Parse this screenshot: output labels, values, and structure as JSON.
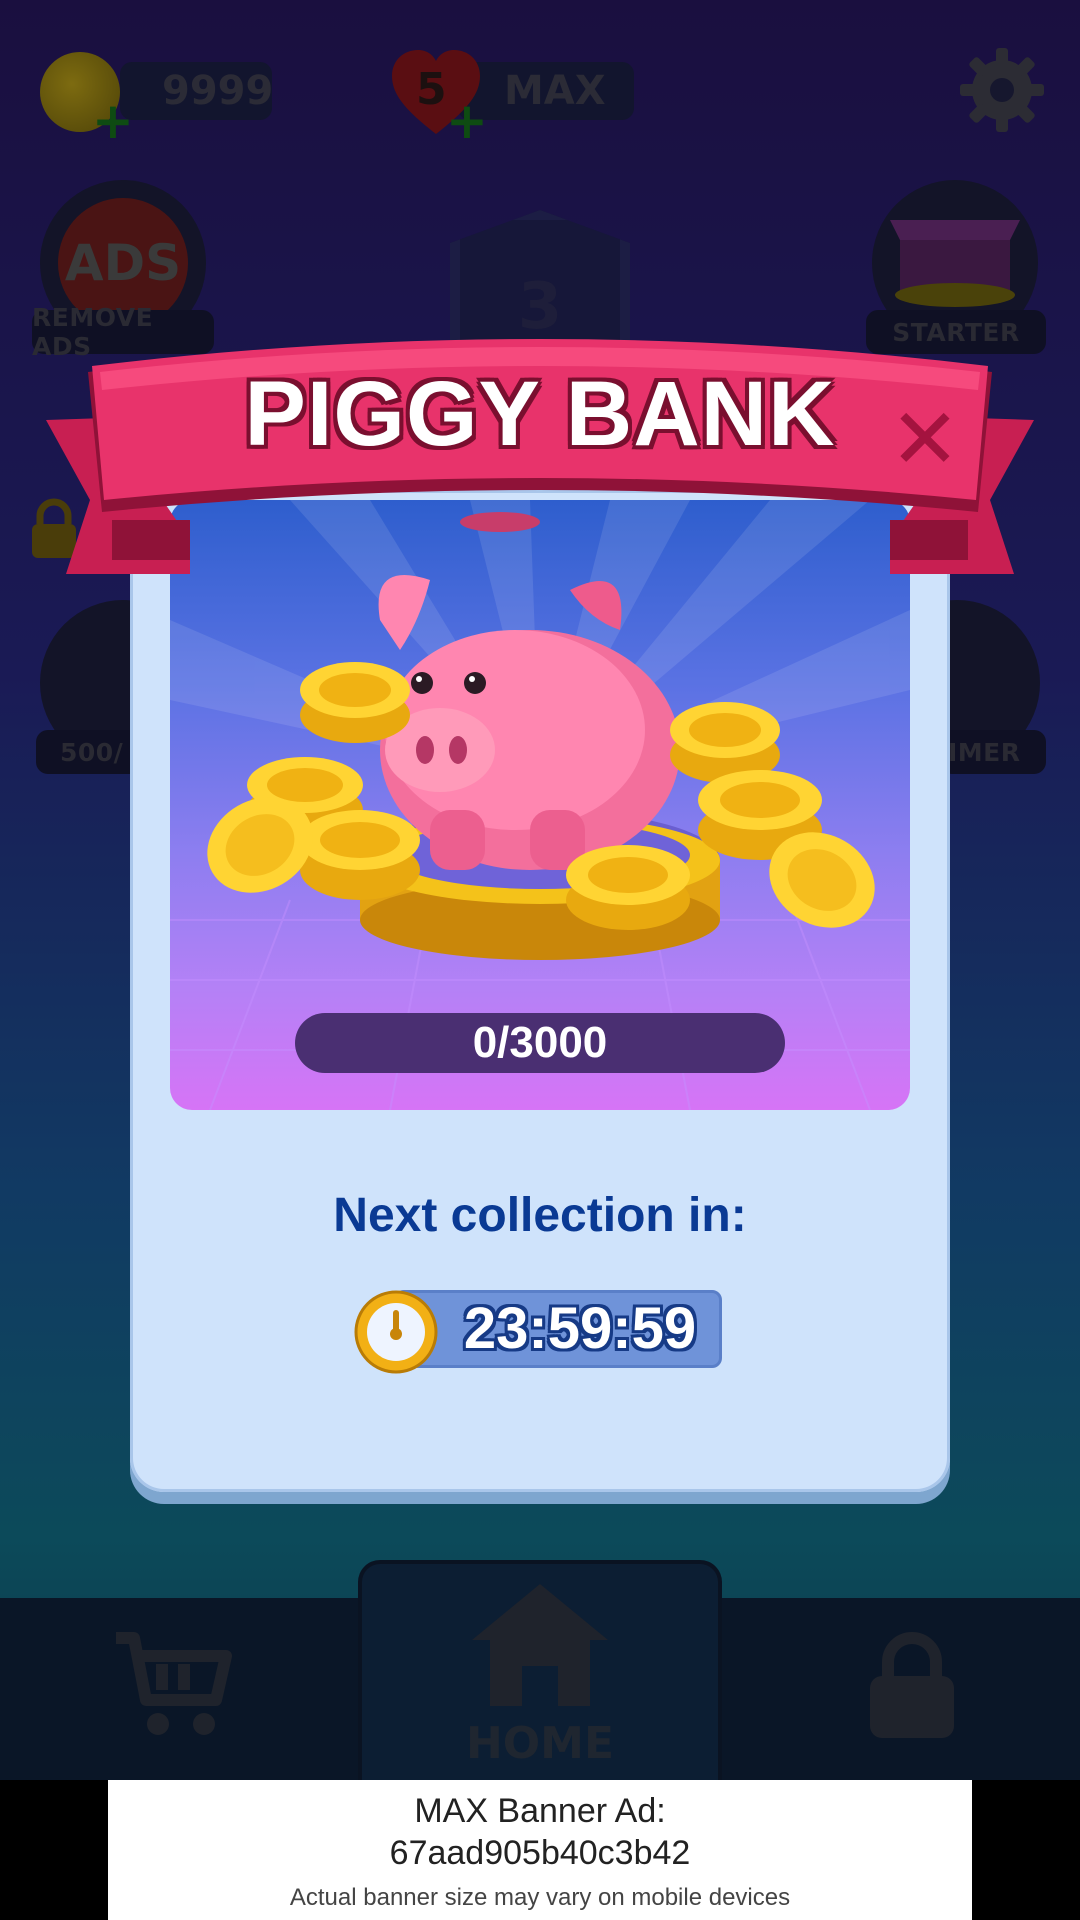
{
  "hud": {
    "coins": "9999",
    "lives": "5",
    "lives_status": "MAX",
    "remove_ads_label": "REMOVE ADS",
    "ads_icon_text": "ADS",
    "starter_label": "STARTER",
    "level": "3",
    "progress_label_partial": "500/",
    "timer_label_partial": "IMER"
  },
  "modal": {
    "title": "PIGGY BANK",
    "close_symbol": "✕",
    "progress": "0/3000",
    "next_label": "Next collection in:",
    "countdown": "23:59:59"
  },
  "nav": {
    "home_label": "HOME"
  },
  "ad": {
    "line1": "MAX Banner Ad:",
    "line2": "67aad905b40c3b42",
    "line3": "Actual banner size may vary on mobile devices"
  },
  "icons": [
    "coin-icon",
    "heart-icon",
    "gear-icon",
    "ads-icon",
    "gift-box-icon",
    "lock-icon",
    "cart-icon",
    "home-icon",
    "piggy-bank-icon",
    "stopwatch-icon",
    "close-icon"
  ],
  "colors": {
    "ribbon": "#e8336b",
    "card": "#cfe3fb",
    "accent_blue": "#0a3a94"
  }
}
